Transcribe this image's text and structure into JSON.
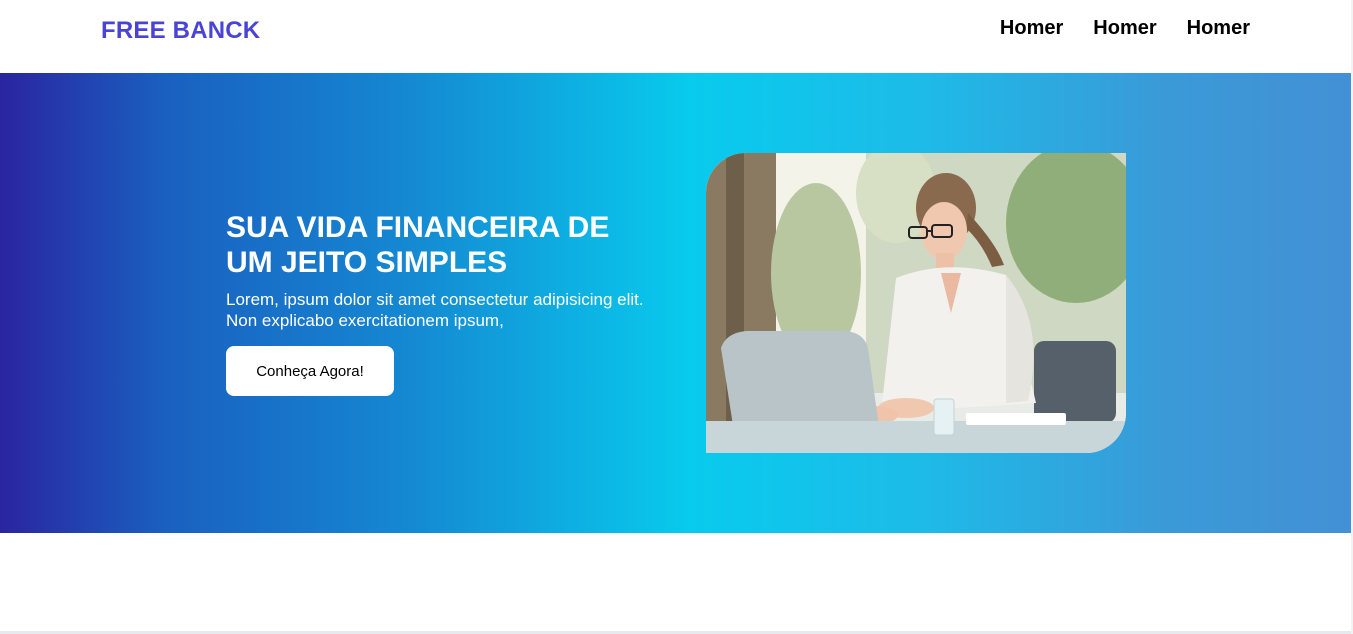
{
  "header": {
    "logo": "FREE BANCK",
    "nav": [
      "Homer",
      "Homer",
      "Homer"
    ]
  },
  "hero": {
    "title": "SUA VIDA FINANCEIRA DE UM JEITO SIMPLES",
    "text": "Lorem, ipsum dolor sit amet consectetur adipisicing elit. Non explicabo exercitationem ipsum,",
    "button_label": "Conheça Agora!"
  },
  "colors": {
    "logo": "#4a44d6",
    "gradient_start": "#2a24a0",
    "gradient_mid": "#08cbed",
    "gradient_end": "#4390d5"
  }
}
